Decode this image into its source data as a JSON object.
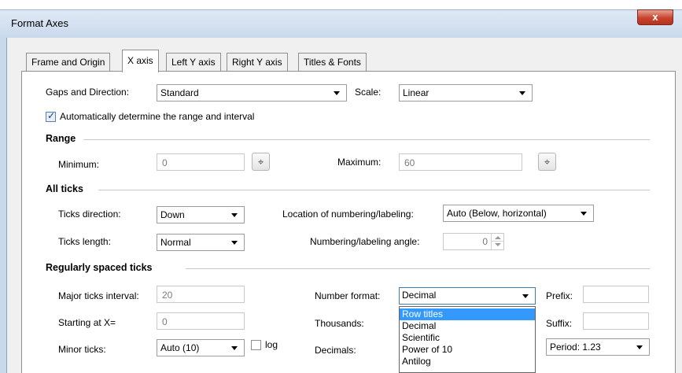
{
  "window": {
    "title": "Format Axes",
    "close_glyph": "x"
  },
  "tabs": [
    {
      "label": "Frame and Origin"
    },
    {
      "label": "X axis"
    },
    {
      "label": "Left Y axis"
    },
    {
      "label": "Right Y axis"
    },
    {
      "label": "Titles & Fonts"
    }
  ],
  "general": {
    "gaps_label": "Gaps and Direction:",
    "gaps_value": "Standard",
    "scale_label": "Scale:",
    "scale_value": "Linear",
    "auto_range_label": "Automatically determine the range and interval",
    "auto_range_checked": true
  },
  "range": {
    "title": "Range",
    "minimum_label": "Minimum:",
    "minimum_value": "0",
    "maximum_label": "Maximum:",
    "maximum_value": "60",
    "picker_icon": "crosshair-picker-icon"
  },
  "all_ticks": {
    "title": "All ticks",
    "direction_label": "Ticks direction:",
    "direction_value": "Down",
    "length_label": "Ticks length:",
    "length_value": "Normal",
    "location_label": "Location of numbering/labeling:",
    "location_value": "Auto (Below, horizontal)",
    "angle_label": "Numbering/labeling angle:",
    "angle_value": "0"
  },
  "regular_ticks": {
    "title": "Regularly spaced ticks",
    "major_label": "Major ticks interval:",
    "major_value": "20",
    "starting_label": "Starting at X=",
    "starting_value": "0",
    "minor_label": "Minor ticks:",
    "minor_value": "Auto (10)",
    "log_label": "log",
    "number_format_label": "Number format:",
    "number_format_value": "Decimal",
    "thousands_label": "Thousands:",
    "decimals_label": "Decimals:",
    "prefix_label": "Prefix:",
    "suffix_label": "Suffix:",
    "period_value": "Period: 1.23"
  },
  "number_format_options": [
    {
      "label": "Row titles",
      "selected": true
    },
    {
      "label": "Decimal"
    },
    {
      "label": "Scientific"
    },
    {
      "label": "Power of 10"
    },
    {
      "label": "Antilog"
    }
  ],
  "colors": {
    "selection": "#3399ff",
    "close_button": "#c7442d",
    "title_bar": "#c9d9ec"
  }
}
